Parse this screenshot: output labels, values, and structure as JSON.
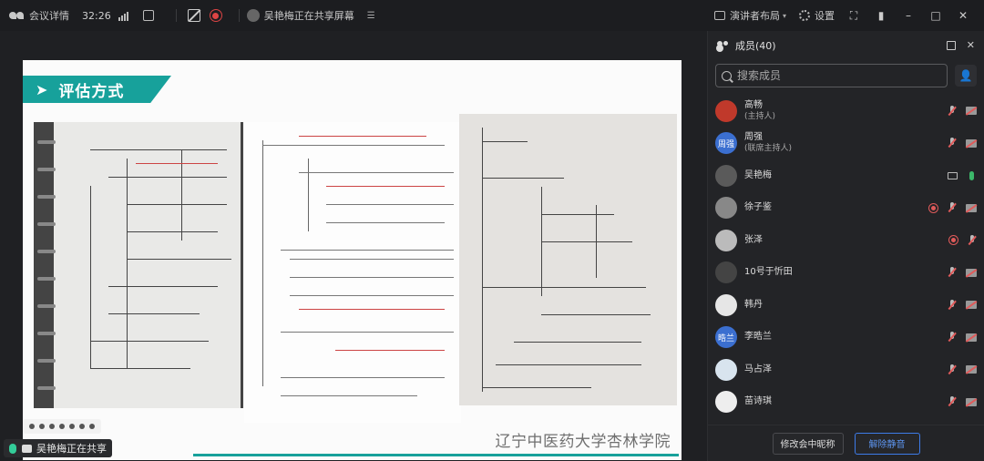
{
  "topbar": {
    "meeting_info_label": "会议详情",
    "timer": "32:26",
    "sharing_status": "吴艳梅正在共享屏幕",
    "layout_label": "演讲者布局",
    "settings_label": "设置"
  },
  "slide": {
    "title": "评估方式",
    "footer_text": "辽宁中医药大学杏林学院",
    "accent_color": "#17a19b"
  },
  "sharer_label": "吴艳梅正在共享",
  "panel": {
    "title": "成员(40)",
    "search_placeholder": "搜索成员",
    "members": [
      {
        "name": "高畅",
        "role": "(主持人)",
        "avatar_text": "",
        "avatar_color": "#c0392b",
        "status": [
          "mic-off",
          "cam-off"
        ]
      },
      {
        "name": "周强",
        "role": "(联席主持人)",
        "avatar_text": "周强",
        "avatar_color": "#3b6fd0",
        "status": [
          "mic-off",
          "cam-off"
        ]
      },
      {
        "name": "吴艳梅",
        "role": "",
        "avatar_text": "",
        "avatar_color": "#5a5a5a",
        "status": [
          "screen",
          "mic-on"
        ]
      },
      {
        "name": "徐子鉴",
        "role": "",
        "avatar_text": "",
        "avatar_color": "#888888",
        "status": [
          "rec",
          "mic-off",
          "cam-off"
        ]
      },
      {
        "name": "张泽",
        "role": "",
        "avatar_text": "",
        "avatar_color": "#bbbbbb",
        "status": [
          "rec",
          "mic-off"
        ]
      },
      {
        "name": "10号于忻田",
        "role": "",
        "avatar_text": "",
        "avatar_color": "#444444",
        "status": [
          "mic-off",
          "cam-off"
        ]
      },
      {
        "name": "韩丹",
        "role": "",
        "avatar_text": "",
        "avatar_color": "#e6e6e6",
        "status": [
          "mic-off",
          "cam-off"
        ]
      },
      {
        "name": "李晧兰",
        "role": "",
        "avatar_text": "晧兰",
        "avatar_color": "#3b6fd0",
        "status": [
          "mic-off",
          "cam-off"
        ]
      },
      {
        "name": "马占泽",
        "role": "",
        "avatar_text": "",
        "avatar_color": "#d8e4ee",
        "status": [
          "mic-off",
          "cam-off"
        ]
      },
      {
        "name": "苗诗琪",
        "role": "",
        "avatar_text": "",
        "avatar_color": "#eeeeee",
        "status": [
          "mic-off",
          "cam-off"
        ]
      }
    ],
    "rename_button": "修改会中昵称",
    "unmute_button": "解除静音"
  }
}
